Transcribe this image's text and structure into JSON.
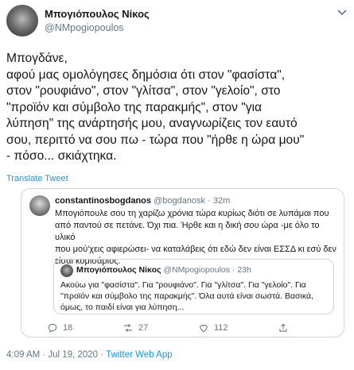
{
  "tweet": {
    "author_name": "Μπογιόπουλος Νίκος",
    "author_handle": "@NMpogiopoulos",
    "text": "Μπογδάνε,\nαφού μας ομολόγησες δημόσια ότι στον \"φασίστα\",\nστον \"ρουφιάνο\", στον \"γλίτσα\", στον \"γελοίο\", στο\n\"προϊόν και σύμβολο της παρακμής\", στον \"για\nλύπηση\" της ανάρτησής μου, αναγνωρίζεις τον εαυτό\nσου, περιττό να σου πω - τώρα που \"ήρθε η ώρα μου\"\n- πόσο... σκιάχτηκα.",
    "translate_label": "Translate Tweet",
    "timestamp": "4:09 AM · Jul 19, 2020 · ",
    "source": "Twitter Web App"
  },
  "quoted_tweet": {
    "author_name": "constantinosbogdanos",
    "author_handle": "@bogdanosk",
    "separator": " · ",
    "time_ago": "32m",
    "text": "Μπογιόπουλε σου τη χαρίζω χρόνια τώρα κυρίως διότι σε λυπάμαι που\nαπό παντού σε πετάνε. Όχι πια. Ήρθε και η δική σου ώρα -με όλο το υλικό\nπου μού'χεις αφιερώσει- να καταλάβεις ότι εδώ δεν είναι ΕΣΣΔ κι εσύ δεν\nείσαι κομισάριος.",
    "nested_quote": {
      "author_name": "Μπογιόπουλος Νίκος",
      "author_handle": "@NMpogiopoulos",
      "separator": " · ",
      "time_ago": "23h",
      "text": "Ακούω για \"φασίστα\". Για \"ρουφιάνο\". Για \"γλίτσα\". Για \"γελοίο\". Για\n\"προϊόν και σύμβολο της παρακμής\". Όλα αυτά είναι σωστά. Βασικά,\nόμως, το παιδί είναι για λύπηση..."
    },
    "actions": {
      "replies": "18",
      "retweets": "27",
      "likes": "112"
    }
  },
  "icons": [
    "chevron-down-icon",
    "reply-icon",
    "retweet-icon",
    "like-icon",
    "share-icon"
  ],
  "colors": {
    "link": "#1b95e0",
    "muted": "#657786",
    "border": "#ccd6dd",
    "text": "#14171a"
  }
}
